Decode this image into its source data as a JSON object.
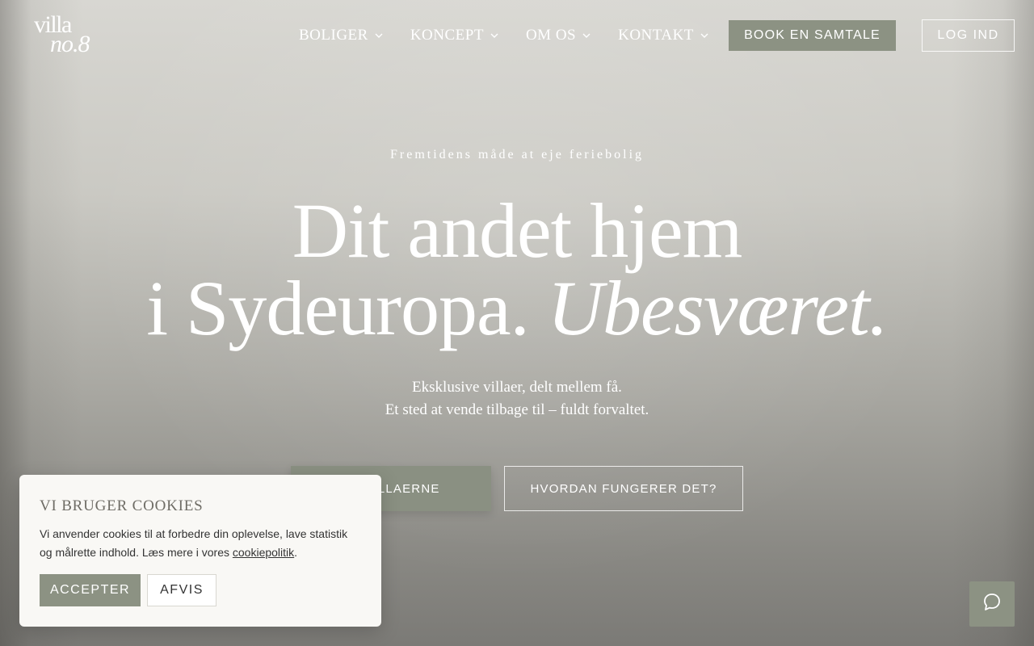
{
  "brand": {
    "logo_line1": "villa",
    "logo_line2": "no.8"
  },
  "nav": {
    "items": [
      {
        "label": "BOLIGER"
      },
      {
        "label": "KONCEPT"
      },
      {
        "label": "OM OS"
      },
      {
        "label": "KONTAKT"
      }
    ],
    "book_label": "BOOK EN SAMTALE",
    "login_label": "LOG IND"
  },
  "hero": {
    "eyebrow": "Fremtidens måde at eje feriebolig",
    "headline_line1": "Dit andet hjem",
    "headline_line2_plain": "i Sydeuropa.",
    "headline_line2_italic": "Ubesværet.",
    "sub_line1": "Eksklusive villaer, delt mellem få.",
    "sub_line2": "Et sted at vende tilbage til – fuldt forvaltet.",
    "primary_button": "SE VILLAERNE",
    "secondary_button": "HVORDAN FUNGERER DET?"
  },
  "cookie": {
    "title": "VI BRUGER COOKIES",
    "text_before": "Vi anvender cookies til at forbedre din oplevelse, lave statistik og målrette indhold. Læs mere i vores",
    "link": "cookiepolitik",
    "text_after": ".",
    "accept": "ACCEPTER",
    "reject": "AFVIS"
  },
  "icons": {
    "chat": "chat-bubble-icon",
    "chevron": "chevron-down-icon"
  },
  "colors": {
    "accent": "#8c9283",
    "cookie_bg": "#f9f8f5"
  }
}
